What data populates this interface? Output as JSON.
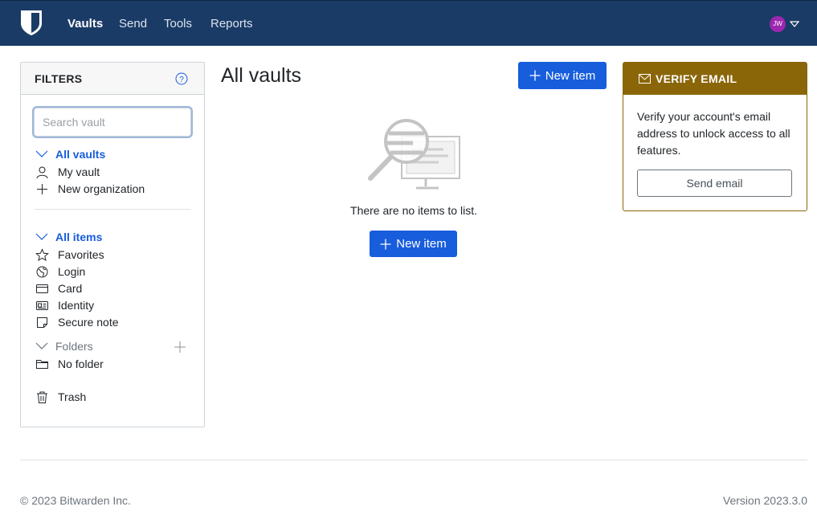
{
  "nav": {
    "links": [
      "Vaults",
      "Send",
      "Tools",
      "Reports"
    ],
    "active": "Vaults",
    "avatar_initials": "JW",
    "avatar_color": "#9c27b0",
    "brand_color": "#1a3b66"
  },
  "filters": {
    "title": "FILTERS",
    "search_placeholder": "Search vault",
    "vaults_header": "All vaults",
    "vault_items": [
      "My vault",
      "New organization"
    ],
    "items_header": "All items",
    "type_items": [
      {
        "label": "Favorites",
        "icon": "star-icon"
      },
      {
        "label": "Login",
        "icon": "globe-icon"
      },
      {
        "label": "Card",
        "icon": "credit-card-icon"
      },
      {
        "label": "Identity",
        "icon": "id-card-icon"
      },
      {
        "label": "Secure note",
        "icon": "sticky-note-icon"
      }
    ],
    "folders_header": "Folders",
    "folder_items": [
      "No folder"
    ],
    "trash_label": "Trash"
  },
  "main": {
    "title": "All vaults",
    "new_item_label": "New item",
    "empty_text": "There are no items to list.",
    "accent_color": "#175ddc"
  },
  "verify": {
    "title": "VERIFY EMAIL",
    "body": "Verify your account's email address to unlock access to all features.",
    "button_label": "Send email",
    "header_color": "#8b6609"
  },
  "footer": {
    "copyright": "© 2023 Bitwarden Inc.",
    "version": "Version 2023.3.0"
  }
}
